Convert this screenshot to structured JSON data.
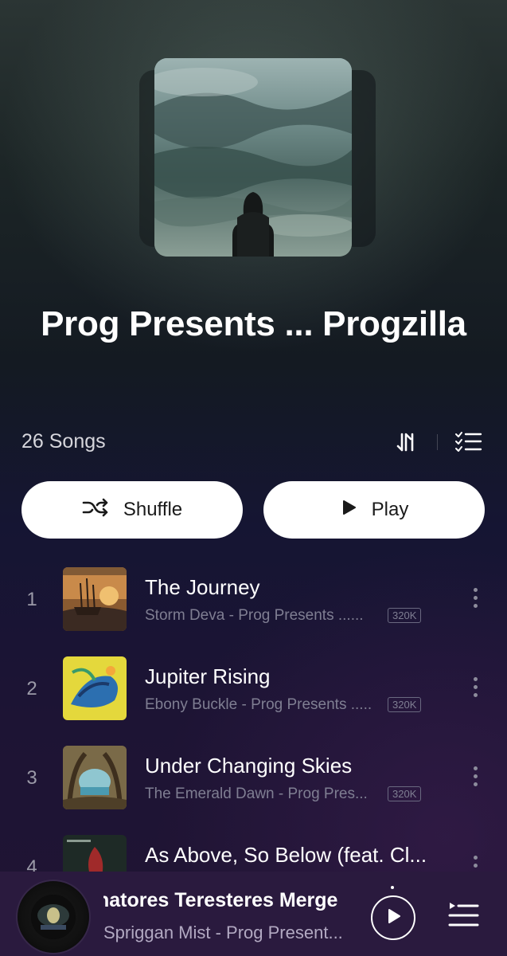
{
  "album": {
    "title": "Prog Presents ... Progzilla"
  },
  "list_header": {
    "songs_count": "26 Songs",
    "sort_icon": "sort-icon",
    "multiselect_icon": "multi-select-list-icon"
  },
  "actions": {
    "shuffle_label": "Shuffle",
    "play_label": "Play"
  },
  "tracks": [
    {
      "number": "1",
      "title": "The Journey",
      "subtitle": "Storm Deva - Prog Presents ......",
      "quality": "320K"
    },
    {
      "number": "2",
      "title": "Jupiter Rising",
      "subtitle": "Ebony Buckle - Prog Presents .....",
      "quality": "320K"
    },
    {
      "number": "3",
      "title": "Under Changing Skies",
      "subtitle": "The Emerald Dawn - Prog Pres...",
      "quality": "320K"
    },
    {
      "number": "4",
      "title": "As Above, So Below (feat. Cl...",
      "subtitle": "",
      "quality": ""
    }
  ],
  "now_playing": {
    "title": "natores Teresteres Merge",
    "subtitle": "Spriggan Mist - Prog Present...",
    "play_icon": "play-icon",
    "queue_icon": "queue-icon"
  },
  "colors": {
    "button_bg": "#ffffff",
    "button_text": "#1a1a1a",
    "secondary_text": "#7f7e92",
    "mini_player_bg": "#2a1a3e"
  }
}
